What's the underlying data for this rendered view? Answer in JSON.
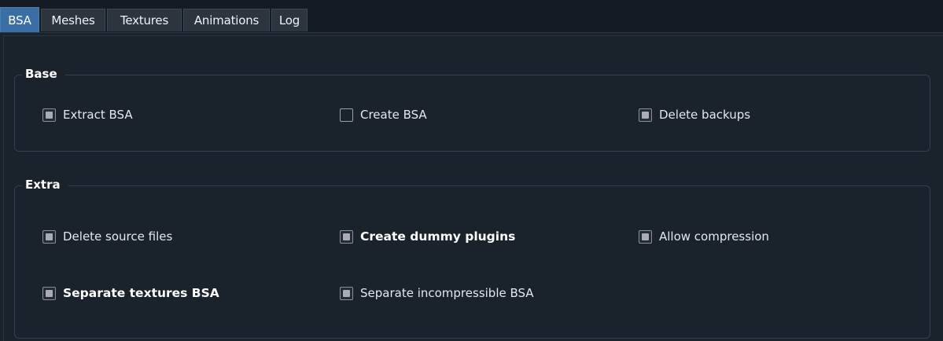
{
  "tabs": [
    {
      "label": "BSA",
      "active": true
    },
    {
      "label": "Meshes",
      "active": false
    },
    {
      "label": "Textures",
      "active": false
    },
    {
      "label": "Animations",
      "active": false
    },
    {
      "label": "Log",
      "active": false
    }
  ],
  "groups": {
    "base": {
      "title": "Base",
      "options": [
        {
          "label": "Extract BSA",
          "checked": true,
          "bold": false
        },
        {
          "label": "Create BSA",
          "checked": false,
          "bold": false
        },
        {
          "label": "Delete backups",
          "checked": true,
          "bold": false
        }
      ]
    },
    "extra": {
      "title": "Extra",
      "options": [
        {
          "label": "Delete source files",
          "checked": true,
          "bold": false
        },
        {
          "label": "Create dummy plugins",
          "checked": true,
          "bold": true
        },
        {
          "label": "Allow compression",
          "checked": true,
          "bold": false
        },
        {
          "label": "Separate textures BSA",
          "checked": true,
          "bold": true
        },
        {
          "label": "Separate incompressible BSA",
          "checked": true,
          "bold": false
        }
      ]
    }
  },
  "colors": {
    "background": "#1a222c",
    "tab_active": "#3a6ea5",
    "checkbox_fill": "#a9adb3"
  }
}
